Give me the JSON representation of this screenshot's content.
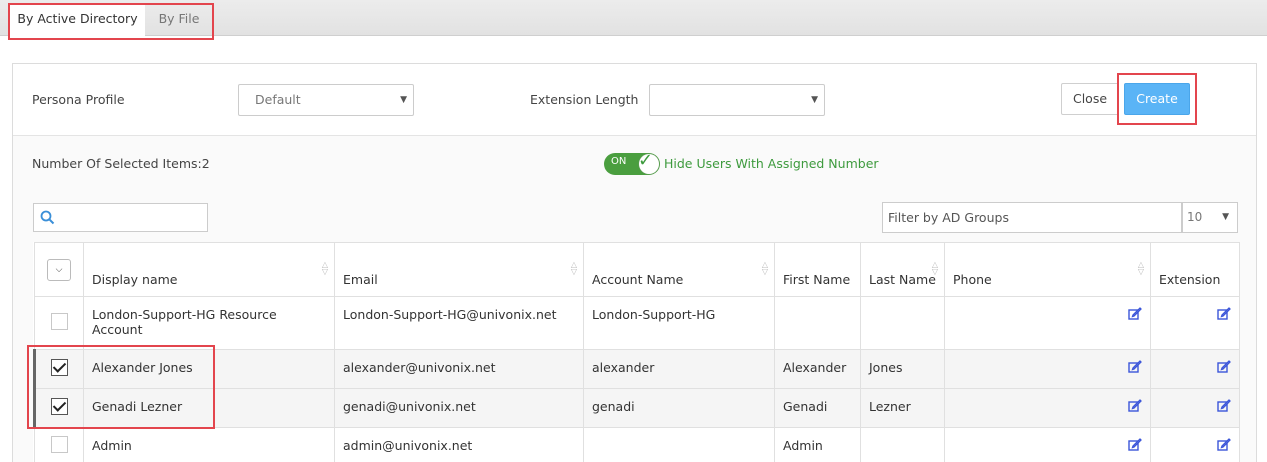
{
  "tabs": [
    {
      "label": "By Active Directory",
      "active": true
    },
    {
      "label": "By File",
      "active": false
    }
  ],
  "form": {
    "persona_label": "Persona Profile",
    "persona_value": "Default",
    "extension_label": "Extension Length",
    "extension_value": "",
    "close_label": "Close",
    "create_label": "Create"
  },
  "selection": {
    "count_text": "Number Of Selected Items:2",
    "toggle_state": "ON",
    "toggle_label": "Hide Users With Assigned Number"
  },
  "filters": {
    "search_value": "",
    "ad_groups_placeholder": "Filter by AD Groups",
    "page_size": "10"
  },
  "table": {
    "columns": [
      "Display name",
      "Email",
      "Account Name",
      "First Name",
      "Last Name",
      "Phone",
      "Extension"
    ],
    "rows": [
      {
        "checked": false,
        "display": "London-Support-HG Resource Account",
        "email": "London-Support-HG@univonix.net",
        "account": "London-Support-HG",
        "first": "",
        "last": "",
        "phone": ""
      },
      {
        "checked": true,
        "display": "Alexander Jones",
        "email": "alexander@univonix.net",
        "account": "alexander",
        "first": "Alexander",
        "last": "Jones",
        "phone": ""
      },
      {
        "checked": true,
        "display": "Genadi Lezner",
        "email": "genadi@univonix.net",
        "account": "genadi",
        "first": "Genadi",
        "last": "Lezner",
        "phone": ""
      },
      {
        "checked": false,
        "display": "Admin",
        "email": "admin@univonix.net",
        "account": "",
        "first": "Admin",
        "last": "",
        "phone": ""
      }
    ]
  },
  "colors": {
    "accent_blue": "#5ab4f6",
    "toggle_green": "#4a9e3f",
    "highlight_red": "#e3454d",
    "edit_icon": "#3b55d9"
  },
  "icons": {
    "search": "search-icon",
    "edit": "edit-icon",
    "sort": "sort-icon",
    "dropdown": "chevron-down-icon"
  }
}
